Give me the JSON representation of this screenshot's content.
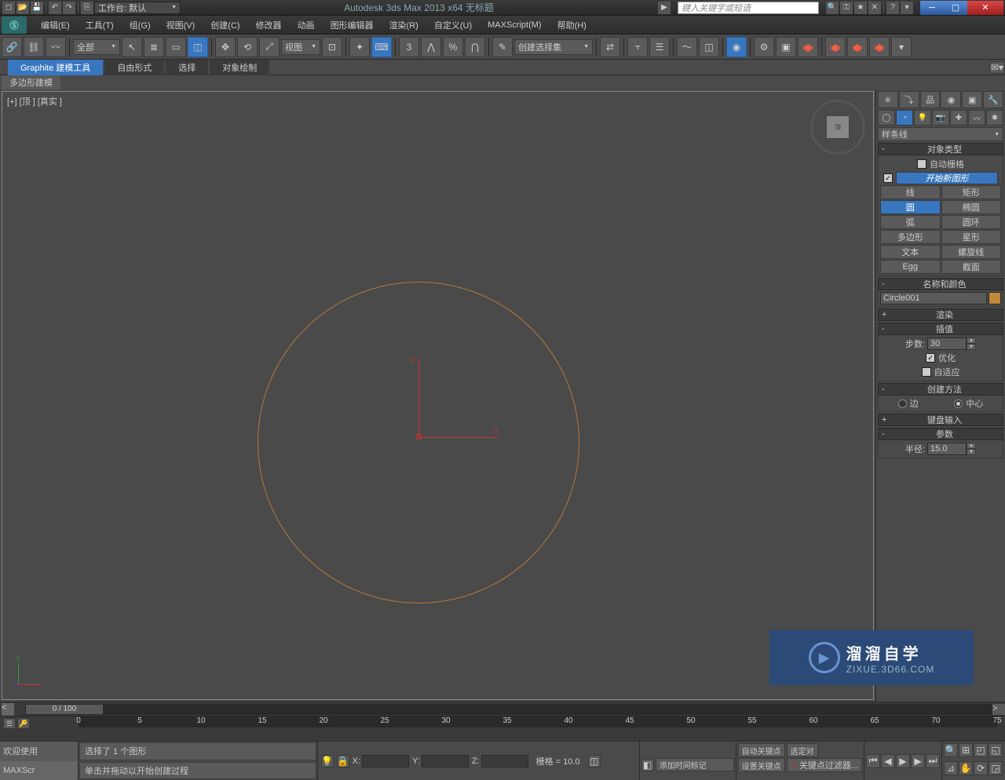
{
  "titlebar": {
    "workspace_label": "工作台: 默认",
    "app_title": "Autodesk 3ds Max  2013 x64    无标题",
    "search_placeholder": "键入关键字或短语"
  },
  "menus": [
    "编辑(E)",
    "工具(T)",
    "组(G)",
    "视图(V)",
    "创建(C)",
    "修改器",
    "动画",
    "图形编辑器",
    "渲染(R)",
    "自定义(U)",
    "MAXScript(M)",
    "帮助(H)"
  ],
  "toolbar": {
    "filter": "全部",
    "ref_dropdown": "视图",
    "named_sel": "创建选择集"
  },
  "ribbon": {
    "tabs": [
      "Graphite 建模工具",
      "自由形式",
      "选择",
      "对象绘制"
    ],
    "sub": "多边形建模"
  },
  "viewport": {
    "label": "[+] [顶 ] [真实 ]",
    "cube_face": "顶"
  },
  "cmd": {
    "dropdown": "样条线",
    "obj_type_title": "对象类型",
    "auto_grid": "自动栅格",
    "start_new": "开始新图形",
    "shapes": [
      {
        "l": "线",
        "r": "矩形"
      },
      {
        "l": "圆",
        "r": "椭圆"
      },
      {
        "l": "弧",
        "r": "圆环"
      },
      {
        "l": "多边形",
        "r": "星形"
      },
      {
        "l": "文本",
        "r": "螺旋线"
      },
      {
        "l": "Egg",
        "r": "截面"
      }
    ],
    "name_title": "名称和颜色",
    "obj_name": "Circle001",
    "render_title": "渲染",
    "interp_title": "插值",
    "steps_label": "步数:",
    "steps_val": "30",
    "optimize": "优化",
    "adaptive": "自适应",
    "creation_title": "创建方法",
    "edge_label": "边",
    "center_label": "中心",
    "keyboard_title": "键盘输入",
    "params_title": "参数",
    "radius_label": "半径:",
    "radius_val": "15.0"
  },
  "timeline": {
    "slider_label": "0 / 100",
    "ticks": [
      0,
      5,
      10,
      15,
      20,
      25,
      30,
      35,
      40,
      45,
      50,
      55,
      60,
      65,
      70,
      75
    ]
  },
  "status": {
    "welcome": "欢迎使用",
    "maxsc": "MAXScr",
    "selected": "选择了 1 个图形",
    "hint": "单击并拖动以开始创建过程",
    "x": "X:",
    "y": "Y:",
    "z": "Z:",
    "grid": "栅格 = 10.0",
    "auto_key": "自动关键点",
    "set_key": "设置关键点",
    "sel_lock": "选定对",
    "key_filter": "关键点过滤器...",
    "add_marker": "添加时间标记"
  },
  "watermark": {
    "zh": "溜溜自学",
    "en": "ZIXUE.3D66.COM"
  }
}
